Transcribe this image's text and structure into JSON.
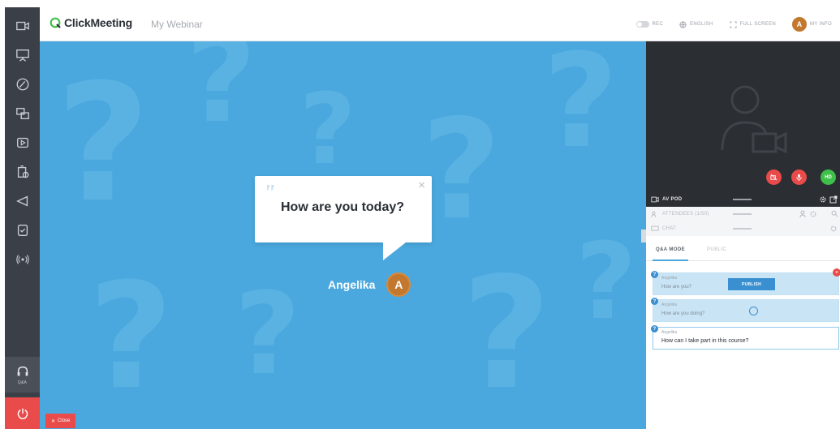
{
  "topbar": {
    "app_name": "ClickMeeting",
    "webinar_name": "My Webinar",
    "rec_label": "REC",
    "language_label": "ENGLISH",
    "fullscreen_label": "FULL SCREEN",
    "avatar_initial": "A",
    "myinfo_label": "MY INFO"
  },
  "sidebar": {
    "items": [
      {
        "icon": "camera-icon"
      },
      {
        "icon": "presentation-icon"
      },
      {
        "icon": "whiteboard-icon"
      },
      {
        "icon": "screen-share-icon"
      },
      {
        "icon": "video-play-icon"
      },
      {
        "icon": "poll-icon"
      },
      {
        "icon": "megaphone-icon"
      },
      {
        "icon": "tests-icon"
      },
      {
        "icon": "broadcast-icon"
      }
    ],
    "active_label": "Q&A",
    "active_icon": "headset-icon",
    "power_icon": "power-icon"
  },
  "stage": {
    "question": "How are you today?",
    "asker": "Angelika",
    "asker_initial": "A",
    "close_label": "Close"
  },
  "panel": {
    "hd_label": "HD",
    "av_pod_label": "AV POD",
    "attendees_label": "ATTENDEES (1/50)",
    "chat_label": "CHAT",
    "tab_qa": "Q&A MODE",
    "tab_public": "PUBLIC",
    "questions": [
      {
        "author": "Angelika",
        "text": "How are you?",
        "action": "PUBLISH"
      },
      {
        "author": "Angelika",
        "text": "How are you doing?"
      },
      {
        "author": "Angelika",
        "text": "How can I take part in this course?"
      }
    ]
  },
  "colors": {
    "stage_blue": "#4aa8de",
    "sidebar_dark": "#3b3f47",
    "accent_red": "#e94a4a",
    "avatar_orange": "#c2782e",
    "hd_green": "#3ec04a"
  }
}
